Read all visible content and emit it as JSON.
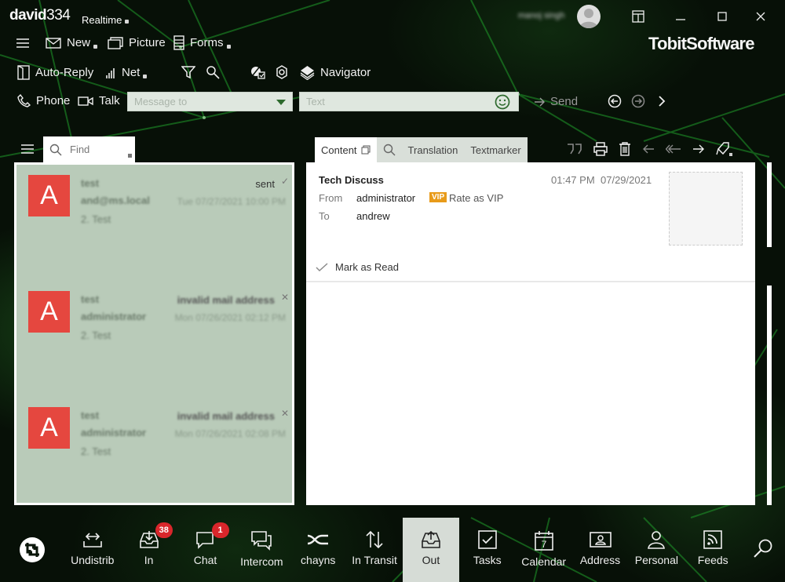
{
  "titlebar": {
    "app_name": "david",
    "app_version": "334",
    "mode_label": "Realtime",
    "user_name": "manoj singh",
    "brand": "TobitSoftware"
  },
  "toolbar": {
    "row1": [
      {
        "name": "menu",
        "label": ""
      },
      {
        "name": "new",
        "label": "New"
      },
      {
        "name": "picture",
        "label": "Picture"
      },
      {
        "name": "forms",
        "label": "Forms"
      }
    ],
    "row2": [
      {
        "name": "auto-reply",
        "label": "Auto-Reply"
      },
      {
        "name": "net",
        "label": "Net"
      },
      {
        "name": "navigator",
        "label": "Navigator"
      }
    ],
    "row3": [
      {
        "name": "phone",
        "label": "Phone"
      },
      {
        "name": "talk",
        "label": "Talk"
      }
    ],
    "message_to_placeholder": "Message to",
    "text_placeholder": "Text",
    "send_label": "Send"
  },
  "list": {
    "find_placeholder": "Find",
    "items": [
      {
        "avatar": "A",
        "from": "test",
        "address": "and@ms.local",
        "preview": "2. Test",
        "status": "sent",
        "date": "Tue 07/27/2021 10:00 PM"
      },
      {
        "avatar": "A",
        "from": "test",
        "address": "administrator",
        "preview": "2. Test",
        "status": "invalid mail address",
        "date": "Mon 07/26/2021 02:12 PM"
      },
      {
        "avatar": "A",
        "from": "test",
        "address": "administrator",
        "preview": "2. Test",
        "status": "invalid mail address",
        "date": "Mon 07/26/2021 02:08 PM"
      }
    ]
  },
  "reader": {
    "tabs": [
      "Content",
      "Translation",
      "Textmarker"
    ],
    "subject": "Tech Discuss",
    "time": "01:47 PM",
    "date": "07/29/2021",
    "from_label": "From",
    "from_value": "administrator",
    "vip_badge": "VIP",
    "vip_label": "Rate as VIP",
    "to_label": "To",
    "to_value": "andrew",
    "mark_read_label": "Mark as Read"
  },
  "nav": {
    "items": [
      {
        "name": "home",
        "label": ""
      },
      {
        "name": "undistrib",
        "label": "Undistrib"
      },
      {
        "name": "in",
        "label": "In",
        "badge": "38"
      },
      {
        "name": "chat",
        "label": "Chat",
        "badge": "1"
      },
      {
        "name": "intercom",
        "label": "Intercom"
      },
      {
        "name": "chayns",
        "label": "chayns"
      },
      {
        "name": "in-transit",
        "label": "In Transit"
      },
      {
        "name": "out",
        "label": "Out",
        "active": true
      },
      {
        "name": "tasks",
        "label": "Tasks"
      },
      {
        "name": "calendar",
        "label": "Calendar",
        "day": "7"
      },
      {
        "name": "address",
        "label": "Address"
      },
      {
        "name": "personal",
        "label": "Personal"
      },
      {
        "name": "feeds",
        "label": "Feeds"
      },
      {
        "name": "search",
        "label": ""
      }
    ]
  },
  "colors": {
    "accent_green": "#2d6a2d",
    "badge_red": "#d9262b",
    "avatar_red": "#e5473f",
    "vip_orange": "#e89b1a",
    "list_bg": "#b9cbb9"
  }
}
